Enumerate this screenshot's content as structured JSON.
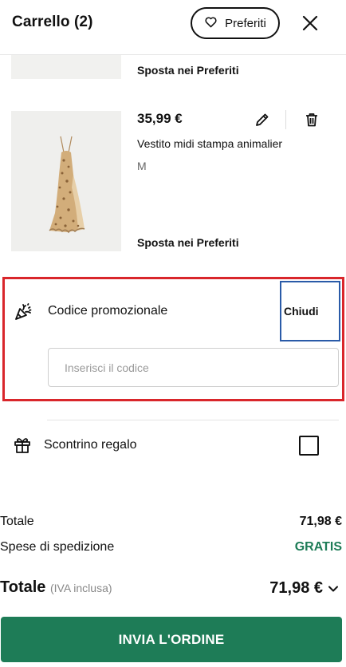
{
  "header": {
    "title": "Carrello (2)",
    "favorites_label": "Preferiti",
    "favorites_icon": "heart-icon",
    "close_icon": "close-icon"
  },
  "cart_items": [
    {
      "move_to_favorites": "Sposta nei Preferiti"
    },
    {
      "price": "35,99 €",
      "name": "Vestito midi stampa animalier",
      "size": "M",
      "edit_icon": "pencil-icon",
      "delete_icon": "trash-icon",
      "move_to_favorites": "Sposta nei Preferiti"
    }
  ],
  "promo": {
    "icon": "party-popper-icon",
    "label": "Codice promozionale",
    "close_label": "Chiudi",
    "input_placeholder": "Inserisci il codice",
    "input_value": ""
  },
  "gift_receipt": {
    "icon": "gift-icon",
    "label": "Scontrino regalo",
    "checked": false
  },
  "summary": {
    "subtotal_label": "Totale",
    "subtotal_value": "71,98 €",
    "shipping_label": "Spese di spedizione",
    "shipping_value": "GRATIS",
    "total_label": "Totale",
    "total_note": "(IVA inclusa)",
    "total_value": "71,98 €"
  },
  "order_button": "INVIA L'ORDINE",
  "colors": {
    "accent_green": "#1e7c57",
    "highlight_red": "#d9262b",
    "focus_blue": "#2a5ba8"
  }
}
